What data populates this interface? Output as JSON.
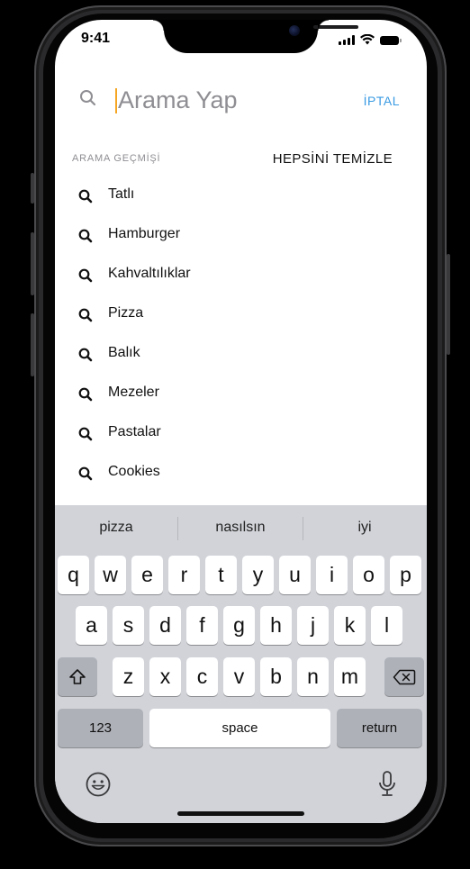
{
  "status_bar": {
    "time": "9:41"
  },
  "search": {
    "placeholder": "Arama Yap",
    "value": "",
    "cancel_label": "İPTAL"
  },
  "history": {
    "title": "ARAMA GEÇMİŞİ",
    "clear_all_label": "HEPSİNİ TEMİZLE",
    "items": [
      "Tatlı",
      "Hamburger",
      "Kahvaltılıklar",
      "Pizza",
      "Balık",
      "Mezeler",
      "Pastalar",
      "Cookies"
    ]
  },
  "keyboard": {
    "suggestions": [
      "pizza",
      "nasılsın",
      "iyi"
    ],
    "row1": [
      "q",
      "w",
      "e",
      "r",
      "t",
      "y",
      "u",
      "i",
      "o",
      "p"
    ],
    "row2": [
      "a",
      "s",
      "d",
      "f",
      "g",
      "h",
      "j",
      "k",
      "l"
    ],
    "row3": [
      "z",
      "x",
      "c",
      "v",
      "b",
      "n",
      "m"
    ],
    "numbers_label": "123",
    "space_label": "space",
    "return_label": "return",
    "shift_icon": "shift-icon",
    "delete_icon": "backspace-icon",
    "emoji_icon": "emoji-icon",
    "mic_icon": "microphone-icon"
  },
  "colors": {
    "accent": "#3a9be3",
    "cursor": "#f5a623",
    "keyboard_bg": "#d1d3d9",
    "special_key": "#aeb1b8"
  }
}
